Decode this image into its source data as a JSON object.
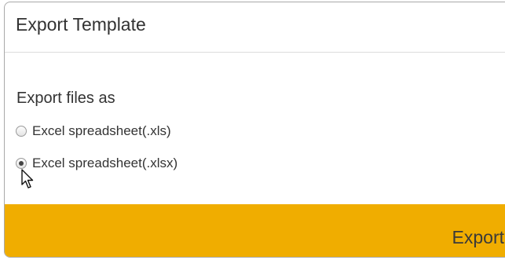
{
  "dialog": {
    "title": "Export Template",
    "section_label": "Export files as",
    "options": [
      {
        "label": "Excel spreadsheet(.xls)",
        "checked": false
      },
      {
        "label": "Excel spreadsheet(.xlsx)",
        "checked": true
      }
    ],
    "export_label": "Export"
  },
  "colors": {
    "footer_bg": "#f0ad00",
    "text": "#333333"
  },
  "icons": {
    "cursor": "mouse-pointer-icon"
  }
}
